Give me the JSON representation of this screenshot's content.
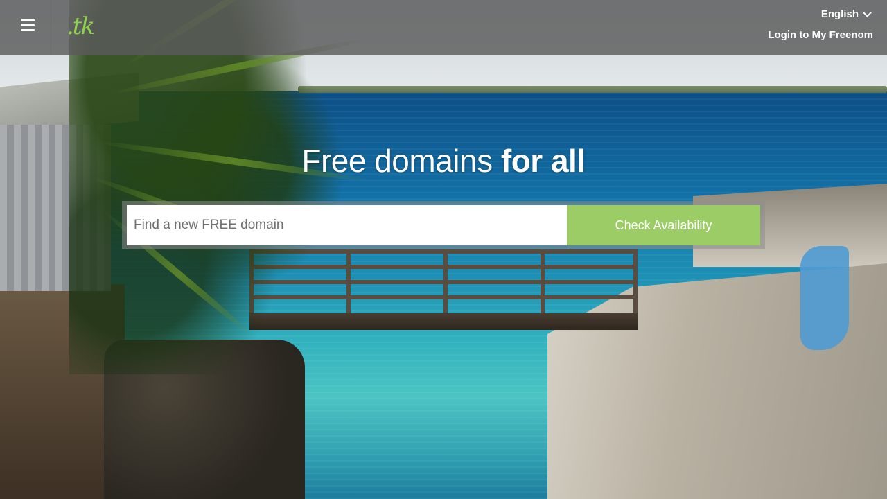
{
  "header": {
    "logo_text": ".tk",
    "language": "English",
    "login_label": "Login to My Freenom"
  },
  "hero": {
    "title_light": "Free domains ",
    "title_bold": "for all"
  },
  "search": {
    "placeholder": "Find a new FREE domain",
    "value": "",
    "button_label": "Check Availability"
  },
  "colors": {
    "accent": "#9ccc65",
    "topbar": "#5a5a5a",
    "logo": "#8fd14f"
  },
  "icons": {
    "menu": "hamburger-menu-icon",
    "language_dropdown": "chevron-down-icon"
  }
}
